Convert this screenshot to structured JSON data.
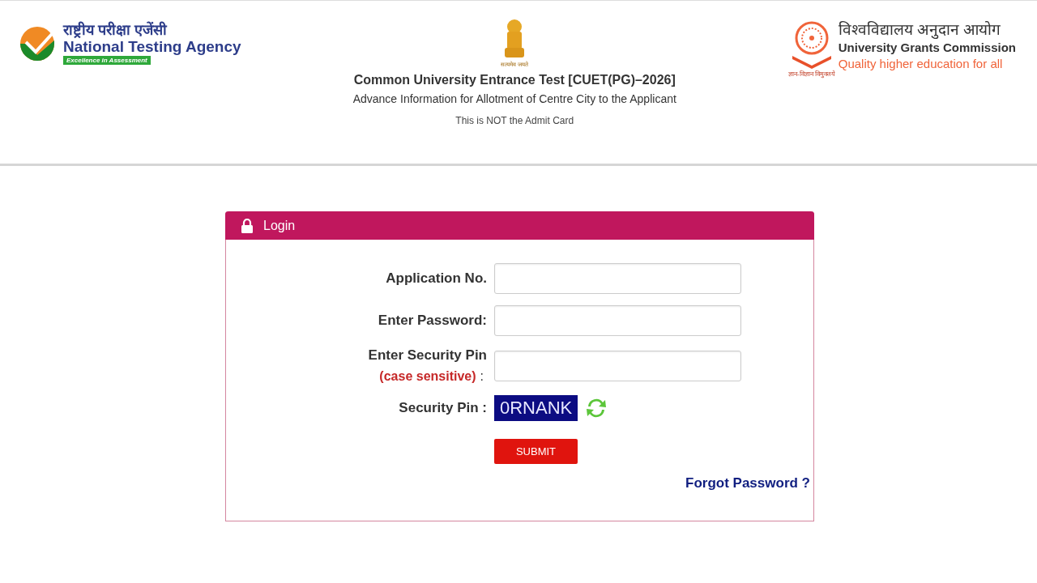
{
  "header": {
    "left_logo": {
      "hindi": "राष्ट्रीय परीक्षा एजेंसी",
      "english": "National Testing Agency",
      "tagline": "Excellence in Assessment"
    },
    "emblem_motto": "सत्यमेव जयते",
    "title": "Common University Entrance Test [CUET(PG)–2026]",
    "subtitle": "Advance Information for Allotment of Centre City to the Applicant",
    "notice": "This is NOT the Admit Card",
    "right_logo": {
      "hindi": "विश्वविद्यालय अनुदान आयोग",
      "english": "University Grants Commission",
      "tagline": "Quality higher education for all",
      "motto": "ज्ञान-विज्ञान विमुक्तये"
    }
  },
  "login": {
    "title": "Login",
    "fields": [
      {
        "label": "Application No."
      },
      {
        "label": "Enter Password:"
      },
      {
        "label": "Enter Security Pin",
        "note": "(case sensitive)",
        "suffix": ":"
      }
    ],
    "security_pin_label": "Security Pin :",
    "captcha": "0RNANK",
    "submit": "SUBMIT",
    "forgot": "Forgot Password ?"
  }
}
